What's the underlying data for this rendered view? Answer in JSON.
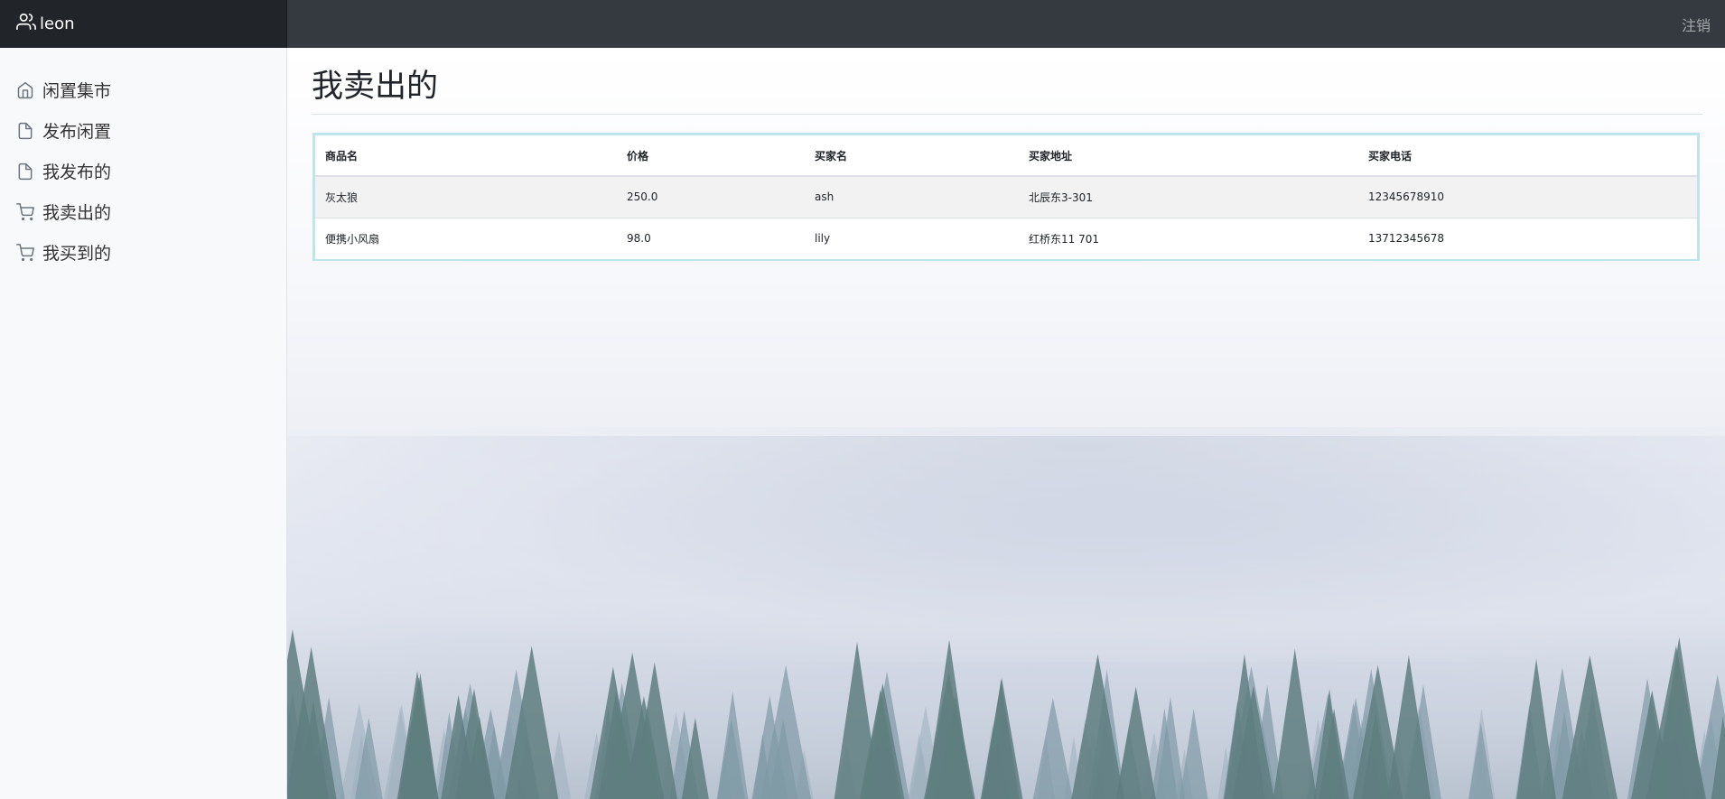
{
  "navbar": {
    "user_name": "leon",
    "user_icon": "users-icon",
    "logout_label": "注销"
  },
  "sidebar": {
    "items": [
      {
        "label": "闲置集市",
        "icon": "home-icon"
      },
      {
        "label": "发布闲置",
        "icon": "file-icon"
      },
      {
        "label": "我发布的",
        "icon": "file-icon"
      },
      {
        "label": "我卖出的",
        "icon": "cart-icon"
      },
      {
        "label": "我买到的",
        "icon": "cart-icon"
      }
    ]
  },
  "main": {
    "title": "我卖出的",
    "table": {
      "headers": [
        "商品名",
        "价格",
        "买家名",
        "买家地址",
        "买家电话"
      ],
      "rows": [
        [
          "灰太狼",
          "250.0",
          "ash",
          "北辰东3-301",
          "12345678910"
        ],
        [
          "便携小风扇",
          "98.0",
          "lily",
          "红桥东11 701",
          "13712345678"
        ]
      ]
    }
  },
  "colors": {
    "navbar_bg": "#343a40",
    "brand_bg": "#212428",
    "table_border": "#bee5eb"
  }
}
